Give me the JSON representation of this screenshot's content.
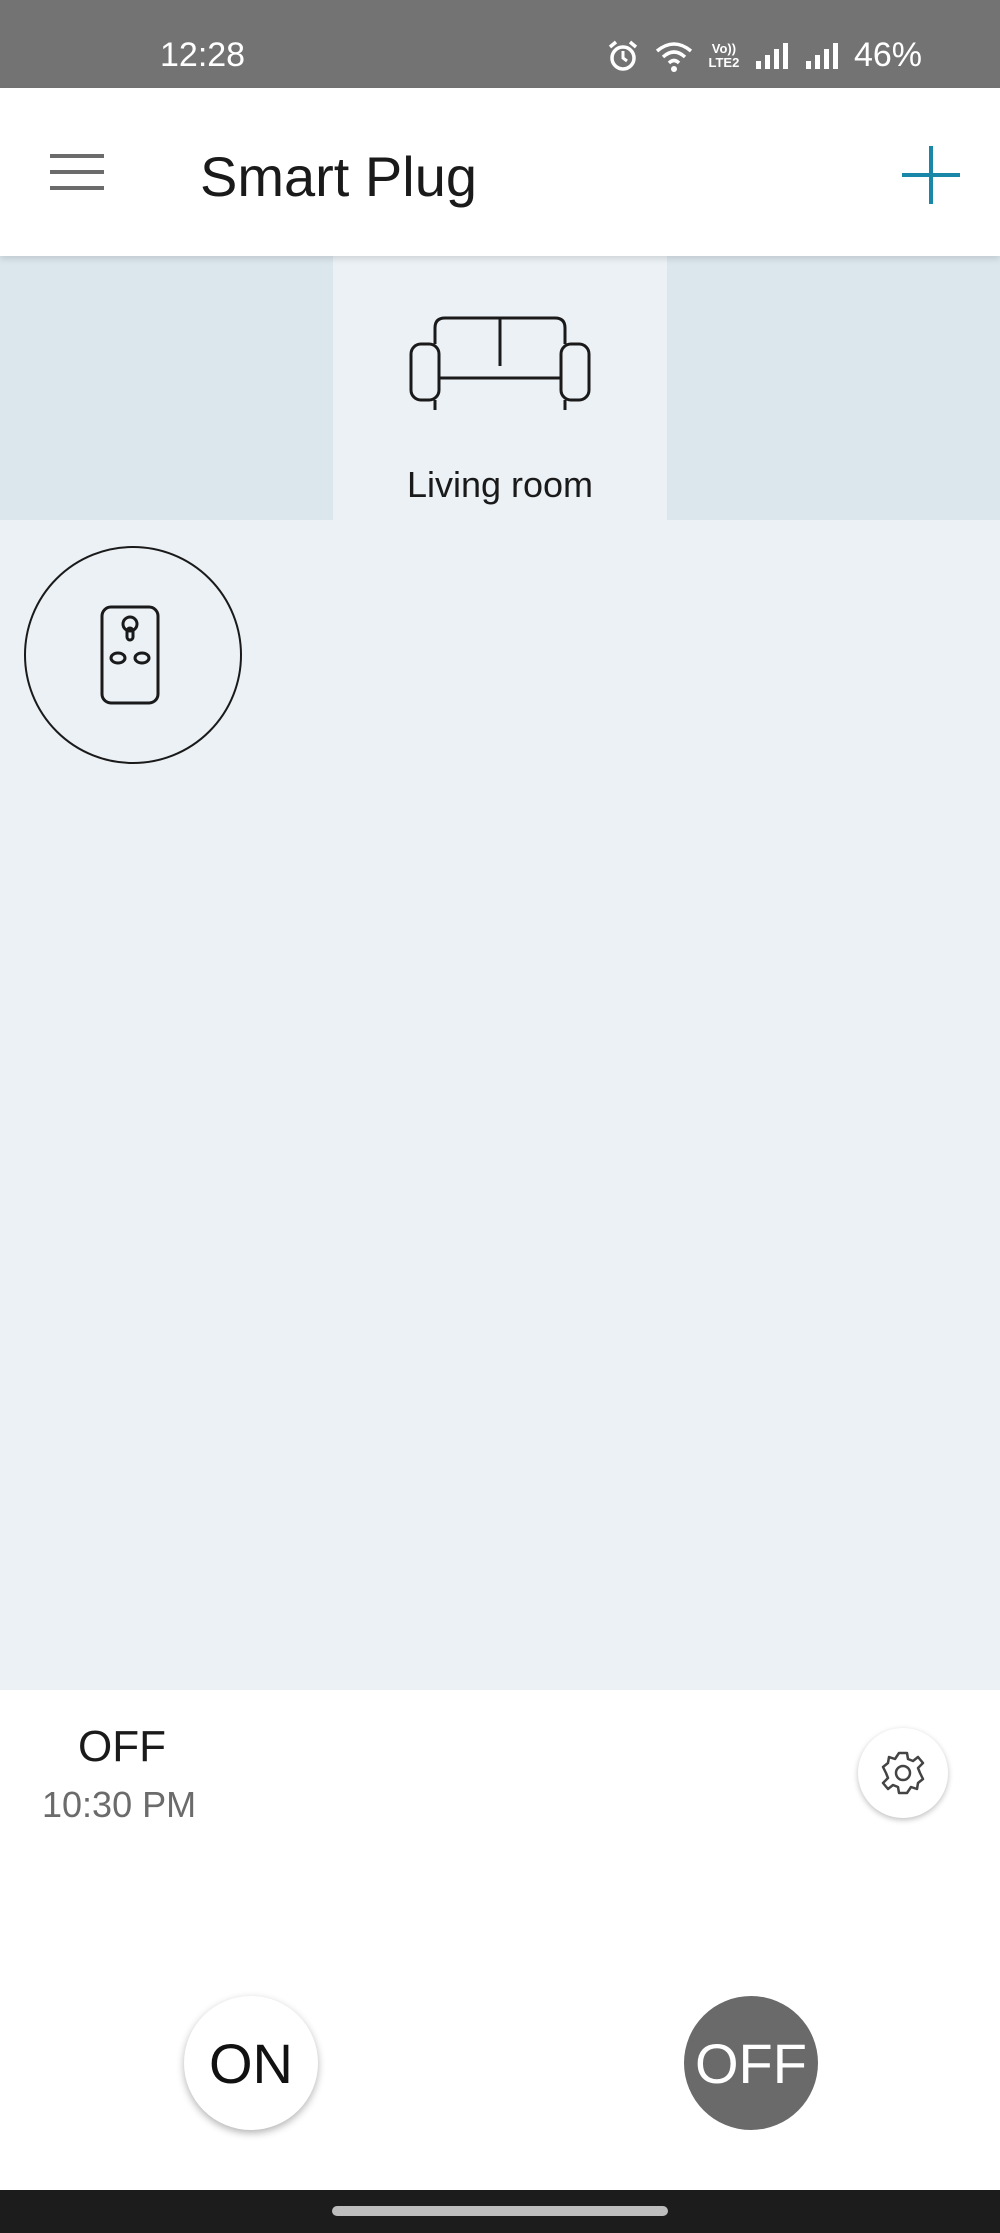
{
  "status_bar": {
    "time": "12:28",
    "battery": "46%",
    "volte_top": "Vo))",
    "volte_bottom": "LTE2"
  },
  "app_bar": {
    "title": "Smart Plug",
    "accent_color": "#1b87a8"
  },
  "rooms": {
    "selected": {
      "label": "Living room",
      "icon": "sofa-icon"
    }
  },
  "device": {
    "icon": "smart-plug-icon",
    "state": "OFF",
    "time": "10:30 PM"
  },
  "controls": {
    "on_label": "ON",
    "off_label": "OFF"
  }
}
